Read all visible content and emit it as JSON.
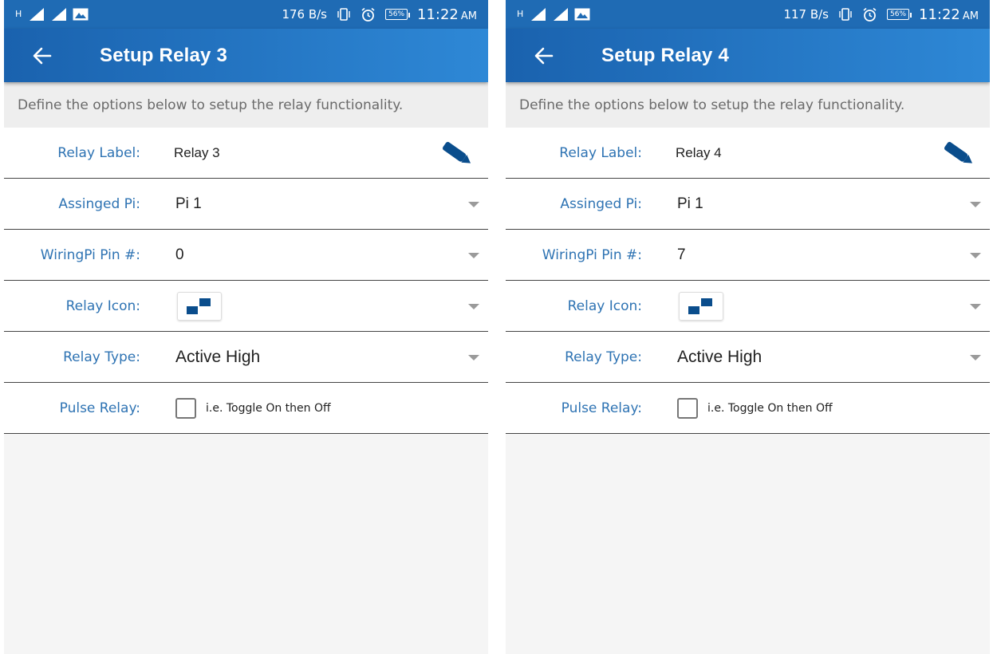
{
  "screens": [
    {
      "statusbar": {
        "network": "H",
        "speed": "176 B/s",
        "battery": "56%",
        "time": "11:22",
        "ampm": "AM",
        "icons": [
          "signal-icon",
          "signal-icon",
          "image-icon",
          "vibrate-icon",
          "alarm-icon",
          "battery-icon"
        ]
      },
      "toolbar": {
        "title": "Setup Relay 3",
        "back_icon": "arrow-left-icon"
      },
      "description": "Define the options below to setup the relay functionality.",
      "fields": {
        "relay_label": {
          "label": "Relay Label:",
          "value": "Relay 3",
          "icon": "pencil-icon"
        },
        "assigned_pi": {
          "label": "Assinged Pi:",
          "value": "Pi 1"
        },
        "wiringpi_pin": {
          "label": "WiringPi Pin #:",
          "value": "0"
        },
        "relay_icon": {
          "label": "Relay Icon:",
          "icon": "relay-steps-icon"
        },
        "relay_type": {
          "label": "Relay Type:",
          "value": "Active High"
        },
        "pulse_relay": {
          "label": "Pulse Relay:",
          "hint": "i.e. Toggle On then Off",
          "checked": false
        }
      }
    },
    {
      "statusbar": {
        "network": "H",
        "speed": "117 B/s",
        "battery": "56%",
        "time": "11:22",
        "ampm": "AM",
        "icons": [
          "signal-icon",
          "signal-icon",
          "image-icon",
          "vibrate-icon",
          "alarm-icon",
          "battery-icon"
        ]
      },
      "toolbar": {
        "title": "Setup Relay 4",
        "back_icon": "arrow-left-icon"
      },
      "description": "Define the options below to setup the relay functionality.",
      "fields": {
        "relay_label": {
          "label": "Relay Label:",
          "value": "Relay 4",
          "icon": "pencil-icon"
        },
        "assigned_pi": {
          "label": "Assinged Pi:",
          "value": "Pi 1"
        },
        "wiringpi_pin": {
          "label": "WiringPi Pin #:",
          "value": "7"
        },
        "relay_icon": {
          "label": "Relay Icon:",
          "icon": "relay-steps-icon"
        },
        "relay_type": {
          "label": "Relay Type:",
          "value": "Active High"
        },
        "pulse_relay": {
          "label": "Pulse Relay:",
          "hint": "i.e. Toggle On then Off",
          "checked": false
        }
      }
    }
  ],
  "colors": {
    "statusbar": "#1f6bb4",
    "toolbar_start": "#1a62ae",
    "toolbar_end": "#2e88d6",
    "label_blue": "#2e73b3",
    "icon_navy": "#0a4d8c"
  }
}
